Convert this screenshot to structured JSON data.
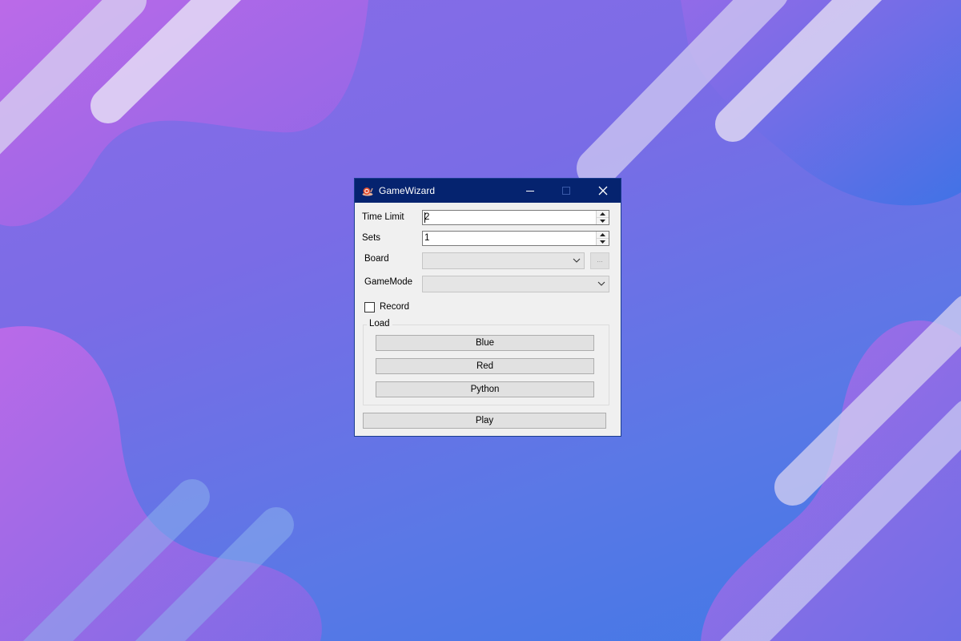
{
  "window": {
    "title": "GameWizard",
    "icon": "snail-icon"
  },
  "form": {
    "time_limit": {
      "label": "Time Limit",
      "value": "2"
    },
    "sets": {
      "label": "Sets",
      "value": "1"
    },
    "board": {
      "label": "Board",
      "value": "",
      "browse_label": "..."
    },
    "gamemode": {
      "label": "GameMode",
      "value": ""
    },
    "record": {
      "label": "Record",
      "checked": false
    }
  },
  "load_group": {
    "title": "Load",
    "buttons": [
      "Blue",
      "Red",
      "Python"
    ]
  },
  "play_button": "Play",
  "colors": {
    "titlebar": "#05236f",
    "window_bg": "#f0f0f0",
    "button_bg": "#e1e1e1"
  }
}
